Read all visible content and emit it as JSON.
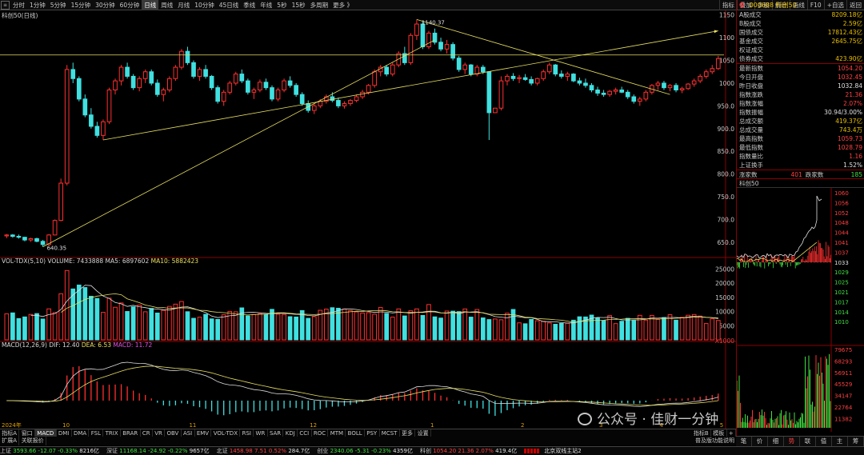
{
  "topbar": {
    "tabs": [
      "分时",
      "1分钟",
      "5分钟",
      "15分钟",
      "30分钟",
      "60分钟",
      "日线",
      "周线",
      "月线",
      "10分钟",
      "45日线",
      "季线",
      "年线",
      "5秒",
      "15秒",
      "多周期",
      "更多 》"
    ],
    "active_tab": "日线",
    "right_tabs": [
      "指标",
      "叠加",
      "多股",
      "统计",
      "画线",
      "F10",
      "+自选",
      "返回"
    ]
  },
  "main_chart": {
    "label": "科创50(日线)",
    "price_axis": [
      "1150",
      "1100",
      "1050",
      "1000",
      "950.0",
      "900.0",
      "850.0",
      "800.0",
      "750.0",
      "700.0",
      "650.0"
    ],
    "high_label": "1140.37",
    "low_label": "640.35",
    "month_labels": [
      "2024年",
      "10",
      "11",
      "12",
      "1",
      "2",
      "3",
      "4",
      "5"
    ]
  },
  "volume": {
    "name": "VOL-TDX(5,10)",
    "volume": "VOLUME: 7433888",
    "ma5": "MA5: 6897602",
    "ma10": "MA10: 5882423",
    "axis": [
      "25000",
      "20000",
      "15000",
      "10000",
      "5000",
      "X1000"
    ]
  },
  "macd": {
    "name": "MACD(12,26,9)",
    "dif": "DIF: 12.40",
    "dea": "DEA: 6.53",
    "macd": "MACD: 11.72"
  },
  "right_panel": {
    "flag": "G",
    "code": "000688 科创50",
    "top_rows": [
      {
        "k": "A股成交",
        "v": "8209.18亿"
      },
      {
        "k": "B股成交",
        "v": "2.59亿"
      },
      {
        "k": "国债成交",
        "v": "17812.43亿"
      },
      {
        "k": "基金成交",
        "v": "2645.75亿"
      },
      {
        "k": "权证成交",
        "v": ""
      },
      {
        "k": "债券成交",
        "v": "423.90亿"
      }
    ],
    "stat_rows": [
      {
        "k": "最新指数",
        "v": "1054.20"
      },
      {
        "k": "今日开盘",
        "v": "1032.45"
      },
      {
        "k": "昨日收盘",
        "v": "1032.84"
      },
      {
        "k": "指数涨跌",
        "v": "21.36"
      },
      {
        "k": "指数涨幅",
        "v": "2.07%"
      },
      {
        "k": "指数振幅",
        "v": "30.94/3.00%"
      },
      {
        "k": "总成交额",
        "v": "419.37亿"
      },
      {
        "k": "总成交量",
        "v": "743.4万"
      },
      {
        "k": "最高指数",
        "v": "1059.73"
      },
      {
        "k": "最低指数",
        "v": "1028.79"
      },
      {
        "k": "指数量比",
        "v": "1.16"
      },
      {
        "k": "上证换手",
        "v": "1.52%"
      }
    ],
    "updown": {
      "up_label": "涨家数",
      "up": "401",
      "down_label": "跌家数",
      "down": "185"
    },
    "mini_title": "科创50",
    "mini_axis": [
      "1060",
      "1056",
      "1052",
      "1048",
      "1044",
      "1041",
      "1037",
      "1033",
      "1029",
      "1025",
      "1021",
      "1017",
      "1014",
      "1010"
    ],
    "mini_vol_axis": [
      "79675",
      "68293",
      "56911",
      "45529",
      "34147",
      "22764",
      "11382"
    ]
  },
  "side_tabs": [
    "笔",
    "价",
    "细",
    "势",
    "联",
    "值",
    "主",
    "筹"
  ],
  "indicator_tabs": [
    "指标A",
    "窗口",
    "MACD",
    "DMI",
    "DMA",
    "FSL",
    "TRIX",
    "BRAR",
    "CR",
    "VR",
    "OBV",
    "ASI",
    "EMV",
    "VOL-TDX",
    "RSI",
    "WR",
    "SAR",
    "KDJ",
    "CCI",
    "ROC",
    "MTM",
    "BOLL",
    "PSY",
    "MCST",
    "更多",
    "设置"
  ],
  "indicator_right": [
    "指标B",
    "模板",
    "+"
  ],
  "expand_row": {
    "tabs": [
      "扩展A",
      "关联报价"
    ],
    "right": "普及版功能说明"
  },
  "statusbar": [
    {
      "name": "上证",
      "price": "3593.66",
      "chg": "-12.07",
      "pct": "-0.33%",
      "amt": "8216亿",
      "dir": "down"
    },
    {
      "name": "深证",
      "price": "11168.14",
      "chg": "-24.92",
      "pct": "-0.22%",
      "amt": "9657亿",
      "dir": "down"
    },
    {
      "name": "北证",
      "price": "1458.98",
      "chg": "7.51",
      "pct": "0.52%",
      "amt": "284.7亿",
      "dir": "up"
    },
    {
      "name": "创业",
      "price": "2340.06",
      "chg": "-5.31",
      "pct": "-0.23%",
      "amt": "4359亿",
      "dir": "down"
    },
    {
      "name": "科创",
      "price": "1054.20",
      "chg": "21.36",
      "pct": "2.07%",
      "amt": "419.4亿",
      "dir": "up"
    }
  ],
  "status_right": "北京双线主站2",
  "watermark": "公众号 · 佳财一分钟",
  "colors": {
    "up": "#ff3030",
    "down": "#40e0e0",
    "bg": "#000000",
    "border": "#8b0000",
    "ma_yellow": "#e8e060"
  },
  "chart_data": {
    "type": "candlestick",
    "title": "科创50(日线)",
    "ylim": [
      620,
      1160
    ],
    "candles": [
      [
        664,
        668,
        659,
        666
      ],
      [
        666,
        668,
        660,
        663
      ],
      [
        663,
        667,
        658,
        661
      ],
      [
        661,
        662,
        652,
        655
      ],
      [
        655,
        660,
        651,
        658
      ],
      [
        658,
        660,
        650,
        652
      ],
      [
        652,
        655,
        640,
        645
      ],
      [
        645,
        668,
        644,
        666
      ],
      [
        666,
        700,
        665,
        698
      ],
      [
        698,
        790,
        696,
        780
      ],
      [
        780,
        1040,
        775,
        1030
      ],
      [
        1030,
        1045,
        1000,
        1010
      ],
      [
        1010,
        1015,
        960,
        965
      ],
      [
        965,
        975,
        925,
        930
      ],
      [
        930,
        945,
        900,
        905
      ],
      [
        905,
        915,
        880,
        885
      ],
      [
        885,
        920,
        875,
        915
      ],
      [
        915,
        990,
        910,
        985
      ],
      [
        985,
        1010,
        975,
        1005
      ],
      [
        1005,
        1040,
        995,
        1035
      ],
      [
        1035,
        1045,
        1010,
        1015
      ],
      [
        1015,
        1020,
        985,
        990
      ],
      [
        990,
        1015,
        982,
        1010
      ],
      [
        1010,
        1030,
        1000,
        1025
      ],
      [
        1025,
        1030,
        995,
        1000
      ],
      [
        1000,
        1008,
        970,
        975
      ],
      [
        975,
        990,
        960,
        985
      ],
      [
        985,
        1015,
        980,
        1010
      ],
      [
        1010,
        1040,
        1005,
        1035
      ],
      [
        1035,
        1075,
        1030,
        1070
      ],
      [
        1070,
        1080,
        1040,
        1045
      ],
      [
        1045,
        1050,
        1010,
        1015
      ],
      [
        1015,
        1035,
        1005,
        1030
      ],
      [
        1030,
        1040,
        1010,
        1015
      ],
      [
        1015,
        1018,
        985,
        990
      ],
      [
        990,
        995,
        955,
        960
      ],
      [
        960,
        985,
        950,
        980
      ],
      [
        980,
        1005,
        975,
        1000
      ],
      [
        1000,
        1025,
        995,
        1020
      ],
      [
        1020,
        1030,
        1000,
        1005
      ],
      [
        1005,
        1010,
        975,
        980
      ],
      [
        980,
        990,
        965,
        985
      ],
      [
        985,
        1008,
        980,
        1002
      ],
      [
        1002,
        1010,
        985,
        990
      ],
      [
        990,
        995,
        960,
        965
      ],
      [
        965,
        990,
        960,
        985
      ],
      [
        985,
        1010,
        980,
        1005
      ],
      [
        1005,
        1015,
        990,
        995
      ],
      [
        995,
        1000,
        970,
        975
      ],
      [
        975,
        980,
        950,
        955
      ],
      [
        955,
        962,
        935,
        940
      ],
      [
        940,
        955,
        932,
        950
      ],
      [
        950,
        965,
        945,
        960
      ],
      [
        960,
        975,
        955,
        970
      ],
      [
        970,
        980,
        958,
        962
      ],
      [
        962,
        968,
        945,
        950
      ],
      [
        950,
        960,
        944,
        955
      ],
      [
        955,
        965,
        950,
        962
      ],
      [
        962,
        975,
        958,
        970
      ],
      [
        970,
        985,
        965,
        980
      ],
      [
        980,
        998,
        975,
        995
      ],
      [
        995,
        1030,
        990,
        1025
      ],
      [
        1025,
        1040,
        1015,
        1035
      ],
      [
        1035,
        1040,
        1015,
        1020
      ],
      [
        1020,
        1045,
        1015,
        1040
      ],
      [
        1040,
        1070,
        1035,
        1065
      ],
      [
        1065,
        1080,
        1040,
        1045
      ],
      [
        1045,
        1110,
        1040,
        1105
      ],
      [
        1105,
        1140,
        1095,
        1130
      ],
      [
        1130,
        1135,
        1075,
        1080
      ],
      [
        1080,
        1115,
        1075,
        1110
      ],
      [
        1110,
        1120,
        1085,
        1090
      ],
      [
        1090,
        1100,
        1070,
        1075
      ],
      [
        1075,
        1095,
        1065,
        1085
      ],
      [
        1085,
        1090,
        1050,
        1055
      ],
      [
        1055,
        1060,
        1025,
        1030
      ],
      [
        1030,
        1045,
        1020,
        1040
      ],
      [
        1040,
        1042,
        1015,
        1020
      ],
      [
        1020,
        1040,
        1015,
        1035
      ],
      [
        1035,
        1040,
        1020,
        1025
      ],
      [
        1025,
        975,
        875,
        935
      ],
      [
        935,
        945,
        935,
        945
      ],
      [
        945,
        1015,
        940,
        1005
      ],
      [
        1005,
        1020,
        995,
        1015
      ],
      [
        1015,
        1022,
        1005,
        1010
      ],
      [
        1010,
        1018,
        1000,
        1012
      ],
      [
        1012,
        1020,
        1005,
        1008
      ],
      [
        1008,
        1015,
        995,
        1000
      ],
      [
        1000,
        1012,
        995,
        1010
      ],
      [
        1010,
        1030,
        1005,
        1025
      ],
      [
        1025,
        1045,
        1020,
        1040
      ],
      [
        1040,
        1042,
        1015,
        1020
      ],
      [
        1020,
        1028,
        1010,
        1015
      ],
      [
        1015,
        1025,
        1005,
        1020
      ],
      [
        1020,
        1022,
        1002,
        1005
      ],
      [
        1005,
        1012,
        995,
        1000
      ],
      [
        1000,
        1010,
        990,
        995
      ],
      [
        995,
        1000,
        980,
        985
      ],
      [
        985,
        992,
        972,
        978
      ],
      [
        978,
        985,
        970,
        975
      ],
      [
        975,
        985,
        970,
        982
      ],
      [
        982,
        990,
        975,
        985
      ],
      [
        985,
        992,
        978,
        980
      ],
      [
        980,
        985,
        965,
        970
      ],
      [
        970,
        975,
        955,
        960
      ],
      [
        960,
        970,
        950,
        965
      ],
      [
        965,
        985,
        960,
        980
      ],
      [
        980,
        998,
        975,
        995
      ],
      [
        995,
        1005,
        985,
        1000
      ],
      [
        1000,
        1005,
        985,
        990
      ],
      [
        990,
        998,
        982,
        995
      ],
      [
        995,
        1000,
        980,
        985
      ],
      [
        985,
        992,
        978,
        988
      ],
      [
        988,
        1000,
        985,
        998
      ],
      [
        998,
        1010,
        992,
        1005
      ],
      [
        1005,
        1020,
        1000,
        1015
      ],
      [
        1015,
        1030,
        1010,
        1025
      ],
      [
        1025,
        1040,
        1020,
        1032
      ],
      [
        1032,
        1060,
        1029,
        1054
      ]
    ],
    "ma_trend_lines": "hand-drawn trend lines"
  }
}
